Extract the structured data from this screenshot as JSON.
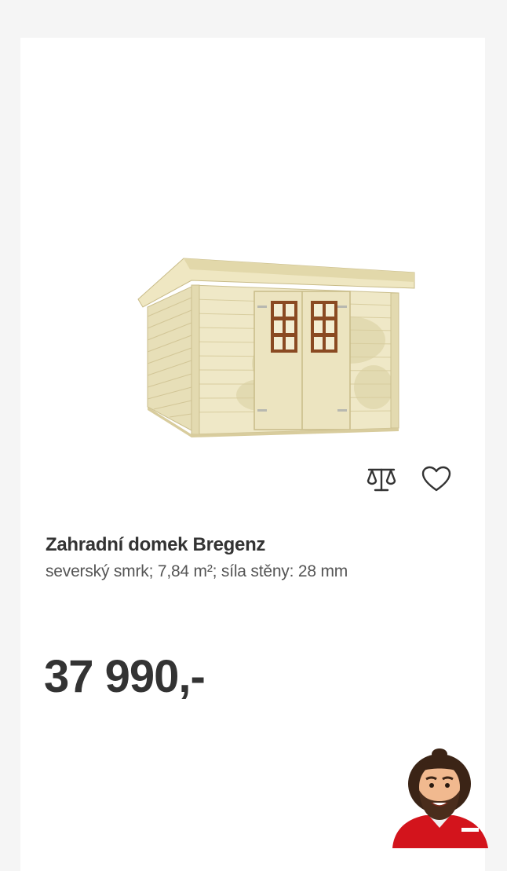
{
  "product": {
    "title": "Zahradní domek Bregenz",
    "subtitle": "severský smrk; 7,84 m²; síla stěny: 28 mm",
    "price": "37 990,-",
    "image_icon": "garden-shed-image"
  },
  "actions": {
    "compare_icon": "scale-compare-icon",
    "wishlist_icon": "heart-icon"
  },
  "assistant": {
    "icon": "assistant-avatar",
    "shirt_color": "#d3141c"
  }
}
